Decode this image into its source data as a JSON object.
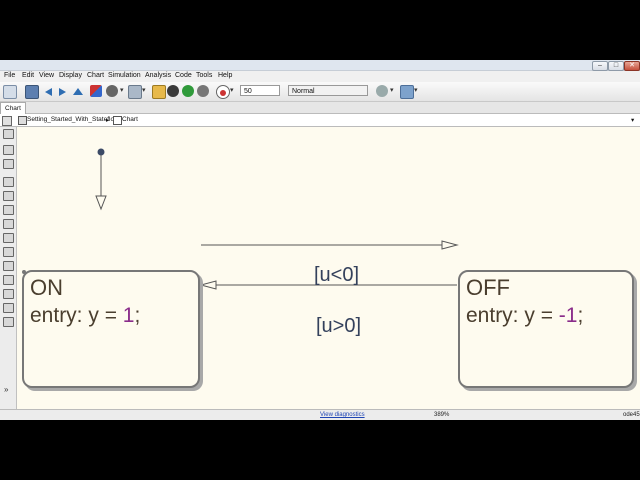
{
  "window": {
    "buttons": {
      "minimize": "–",
      "maximize": "□",
      "close": "✕"
    }
  },
  "menubar": {
    "items": [
      "File",
      "Edit",
      "View",
      "Display",
      "Chart",
      "Simulation",
      "Analysis",
      "Code",
      "Tools",
      "Help"
    ]
  },
  "toolbar": {
    "stop_time": "50",
    "sim_mode": "Normal"
  },
  "tabs": [
    {
      "label": "Chart"
    }
  ],
  "breadcrumb": {
    "model": "Setting_Started_With_Stateflow",
    "chart": "Chart"
  },
  "chart": {
    "states": [
      {
        "name": "ON",
        "action_prefix": "entry: y = ",
        "action_value": "1",
        "action_suffix": ";"
      },
      {
        "name": "OFF",
        "action_prefix": "entry: y = ",
        "action_value": "-1",
        "action_suffix": ";"
      }
    ],
    "transitions": [
      {
        "label": "[u<0]"
      },
      {
        "label": "[u>0]"
      }
    ]
  },
  "status": {
    "diagnostics_link": "View diagnostics",
    "zoom": "389%",
    "solver": "ode45"
  },
  "colors": {
    "canvas_background": "#fefbef",
    "state_border": "#777777",
    "state_text": "#4a3e2e",
    "number_text": "#8a2c8a",
    "transition_label": "#34415c"
  }
}
